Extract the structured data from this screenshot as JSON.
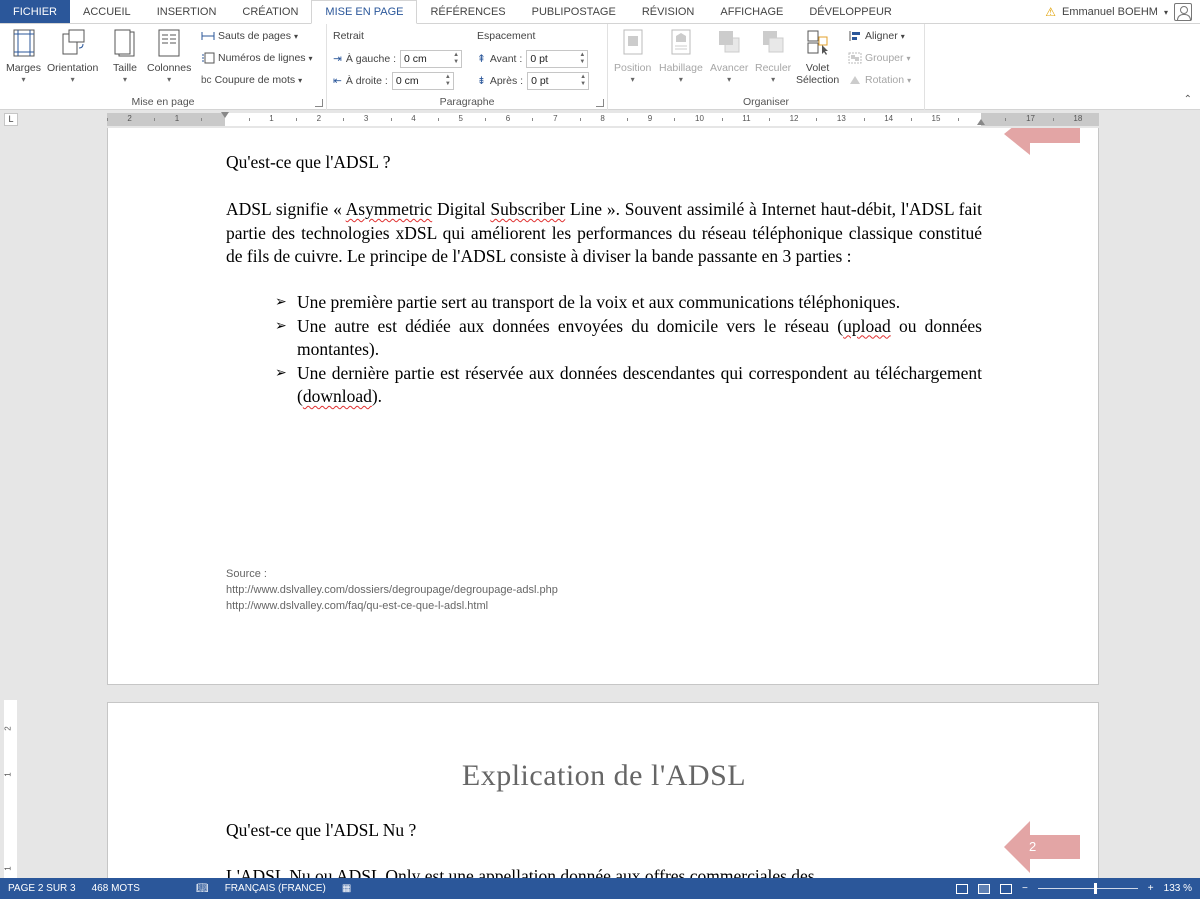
{
  "tabs": [
    {
      "label": "FICHIER",
      "name": "tab-fichier",
      "type": "file"
    },
    {
      "label": "ACCUEIL",
      "name": "tab-accueil"
    },
    {
      "label": "INSERTION",
      "name": "tab-insertion"
    },
    {
      "label": "CRÉATION",
      "name": "tab-creation"
    },
    {
      "label": "MISE EN PAGE",
      "name": "tab-mise-en-page",
      "type": "active"
    },
    {
      "label": "RÉFÉRENCES",
      "name": "tab-references"
    },
    {
      "label": "PUBLIPOSTAGE",
      "name": "tab-publipostage"
    },
    {
      "label": "RÉVISION",
      "name": "tab-revision"
    },
    {
      "label": "AFFICHAGE",
      "name": "tab-affichage"
    },
    {
      "label": "DÉVELOPPEUR",
      "name": "tab-developpeur"
    }
  ],
  "user": {
    "name": "Emmanuel BOEHM"
  },
  "ribbon": {
    "mise_en_page": {
      "label": "Mise en page",
      "marges": "Marges",
      "orientation": "Orientation",
      "taille": "Taille",
      "colonnes": "Colonnes",
      "sauts": "Sauts de pages",
      "numeros": "Numéros de lignes",
      "coupure": "Coupure de mots"
    },
    "paragraphe": {
      "label": "Paragraphe",
      "retrait": "Retrait",
      "gauche_label": "À gauche :",
      "gauche_value": "0 cm",
      "droite_label": "À droite :",
      "droite_value": "0 cm",
      "espacement": "Espacement",
      "avant_label": "Avant :",
      "avant_value": "0 pt",
      "apres_label": "Après :",
      "apres_value": "0 pt"
    },
    "organiser": {
      "label": "Organiser",
      "position": "Position",
      "habillage": "Habillage",
      "avancer": "Avancer",
      "reculer": "Reculer",
      "volet_line1": "Volet",
      "volet_line2": "Sélection",
      "aligner": "Aligner",
      "grouper": "Grouper",
      "rotation": "Rotation"
    }
  },
  "ruler": {
    "box_label": "L",
    "numbers": [
      "2",
      "1",
      "",
      "1",
      "2",
      "3",
      "4",
      "5",
      "6",
      "7",
      "8",
      "9",
      "10",
      "11",
      "12",
      "13",
      "14",
      "15",
      "",
      "17",
      "18"
    ]
  },
  "vruler": {
    "numbers": [
      "2",
      "1",
      "1"
    ]
  },
  "page1": {
    "question": "Qu'est-ce que l'ADSL ?",
    "para_part1": "ADSL signifie « ",
    "para_asym": "Asymmetric",
    "para_part2": " Digital ",
    "para_sub": "Subscriber",
    "para_part3": " Line ». Souvent assimilé à Internet haut-débit, l'ADSL fait partie des technologies xDSL qui améliorent les performances du réseau téléphonique classique constitué de fils de cuivre. Le principe de l'ADSL consiste à diviser la bande passante en 3 parties :",
    "bullet1": "Une première partie sert au transport de la voix et aux communications téléphoniques.",
    "bullet2_part1": "Une autre est dédiée aux données envoyées du domicile vers le réseau (",
    "bullet2_upload": "upload",
    "bullet2_part2": " ou données montantes).",
    "bullet3_part1": "Une dernière partie est réservée aux données descendantes qui correspondent au téléchargement (",
    "bullet3_download": "download",
    "bullet3_part2": ").",
    "source_label": "Source :",
    "source_url1": "http://www.dslvalley.com/dossiers/degroupage/degroupage-adsl.php",
    "source_url2": "http://www.dslvalley.com/faq/qu-est-ce-que-l-adsl.html"
  },
  "page2": {
    "heading": "Explication de l'ADSL",
    "question": "Qu'est-ce que l'ADSL Nu ?",
    "partial": "L'ADSL Nu ou ADSL Only est une appellation donnée aux offres commerciales des",
    "arrow_number": "2"
  },
  "status": {
    "page": "PAGE 2 SUR 3",
    "words": "468 MOTS",
    "language": "FRANÇAIS (FRANCE)",
    "zoom": "133 %",
    "zoom_level": 0.56
  },
  "colors": {
    "accent": "#2b579a",
    "arrow": "#e3a5a5"
  }
}
